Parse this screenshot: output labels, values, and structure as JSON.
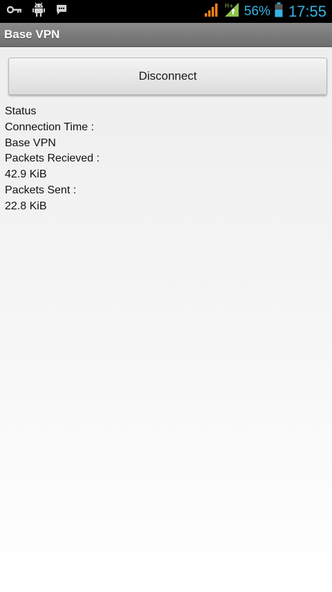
{
  "status_bar": {
    "icons_left": [
      "key-icon",
      "android-debug-icon",
      "chat-notification-icon"
    ],
    "battery_percent": "56%",
    "clock": "17:55",
    "network_type": "H+",
    "colors": {
      "accent": "#33b5e5",
      "signal_orange": "#f0801e",
      "signal_green": "#8bc34a"
    }
  },
  "app": {
    "title": "Base VPN"
  },
  "actions": {
    "disconnect_label": "Disconnect"
  },
  "info": {
    "status_label": "Status",
    "connection_time_label": "Connection Time :",
    "connection_name": "Base VPN",
    "packets_received_label": "Packets Recieved :",
    "packets_received_value": "42.9 KiB",
    "packets_sent_label": "Packets Sent :",
    "packets_sent_value": "22.8 KiB"
  }
}
